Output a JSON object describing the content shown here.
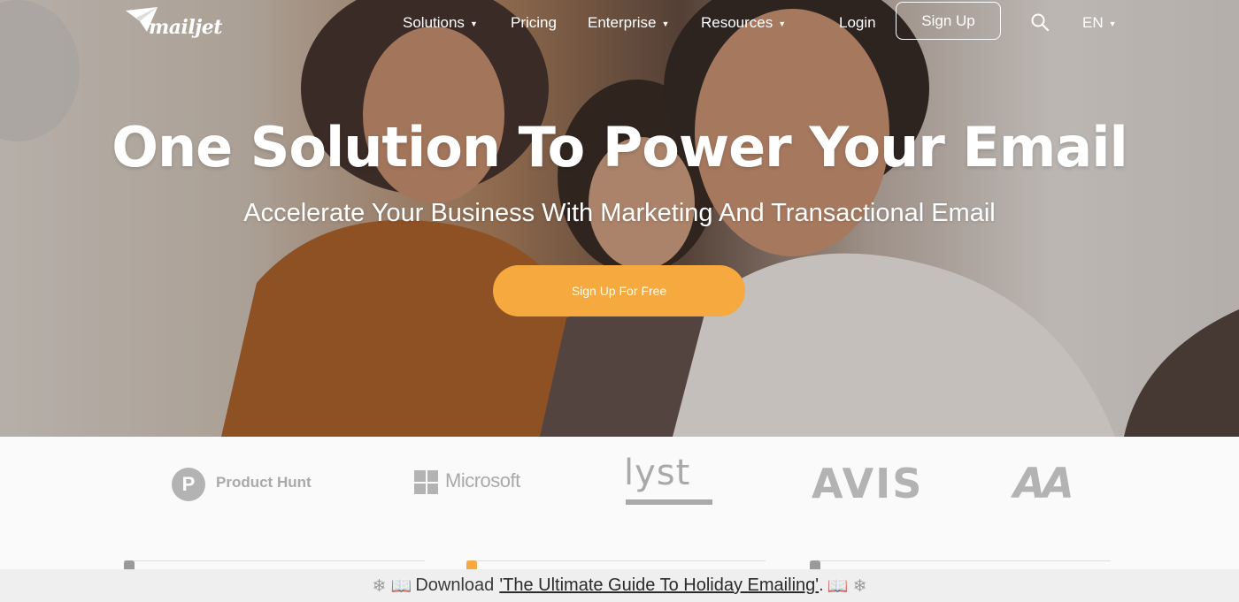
{
  "brand": {
    "logo_text": "mailjet"
  },
  "nav": {
    "items": [
      {
        "label": "Solutions",
        "has_caret": true
      },
      {
        "label": "Pricing",
        "has_caret": false
      },
      {
        "label": "Enterprise",
        "has_caret": true
      },
      {
        "label": "Resources",
        "has_caret": true
      }
    ],
    "login": "Login",
    "signup": "Sign Up",
    "language": "EN",
    "caret": "▼",
    "search_icon": "search-icon"
  },
  "hero": {
    "headline": "One Solution To Power Your Email",
    "subheadline": "Accelerate Your Business With Marketing And Transactional Email",
    "cta": "Sign Up For Free"
  },
  "logos": {
    "product_hunt_initial": "P",
    "product_hunt": "Product Hunt",
    "microsoft": "Microsoft",
    "lyst": "lyst",
    "avis": "AVIS",
    "aa": "AA"
  },
  "banner": {
    "left_glyph": "❄ 📖",
    "prefix": "Download",
    "link": "'The Ultimate Guide To Holiday Emailing'",
    "suffix": ".",
    "right_glyph": "📖 ❄"
  },
  "colors": {
    "cta": "#f5a93f",
    "logo_gray": "#a9a9a9",
    "banner_bg": "#efefef"
  }
}
